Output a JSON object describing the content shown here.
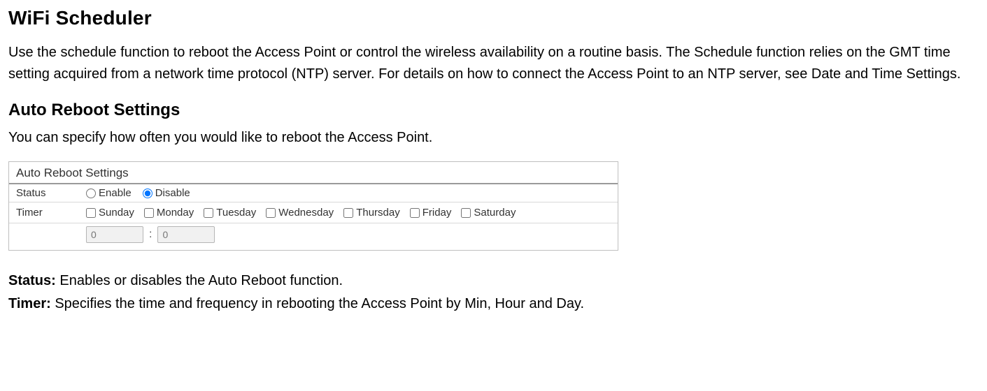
{
  "page": {
    "title": "WiFi Scheduler",
    "intro": "Use the schedule function to reboot the Access Point or control the wireless availability on a routine basis. The Schedule function relies on the GMT time setting acquired from a network time protocol (NTP) server. For details on how to connect the Access Point to an NTP server, see Date and Time Settings."
  },
  "section": {
    "title": "Auto Reboot Settings",
    "intro": "You can specify how often you would like to reboot the Access Point."
  },
  "panel": {
    "header": "Auto Reboot Settings",
    "status": {
      "label": "Status",
      "enable_label": "Enable",
      "disable_label": "Disable",
      "selected": "disable"
    },
    "timer": {
      "label": "Timer",
      "days": [
        "Sunday",
        "Monday",
        "Tuesday",
        "Wednesday",
        "Thursday",
        "Friday",
        "Saturday"
      ],
      "hour": "0",
      "minute": "0"
    }
  },
  "defs": {
    "status_label": "Status:",
    "status_text": " Enables or disables the Auto Reboot function.",
    "timer_label": "Timer:",
    "timer_text": " Specifies the time and frequency in rebooting the Access Point by Min, Hour and Day."
  }
}
